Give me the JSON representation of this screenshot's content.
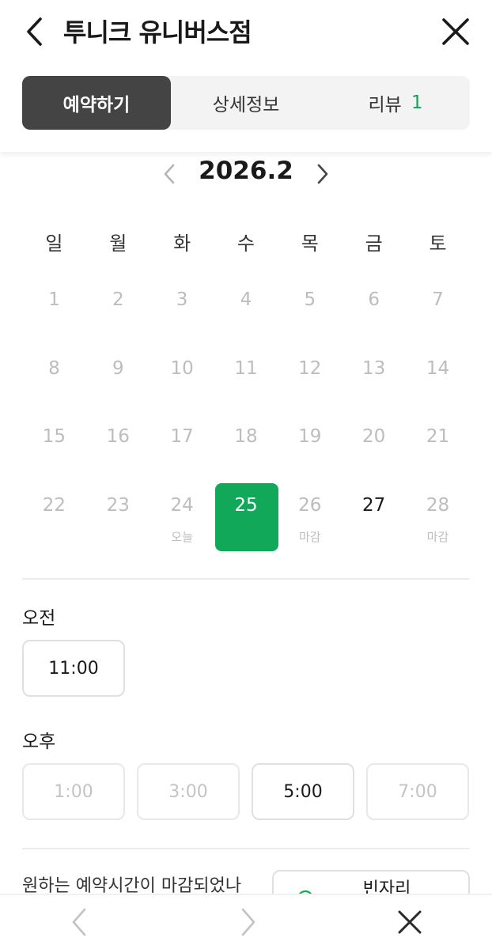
{
  "header": {
    "title": "투니크 유니버스점"
  },
  "tabs": [
    {
      "label": "예약하기",
      "active": true
    },
    {
      "label": "상세정보",
      "active": false
    },
    {
      "label": "리뷰",
      "count": "1",
      "active": false
    }
  ],
  "calendar": {
    "month_label": "2026.2",
    "weekdays": [
      "일",
      "월",
      "화",
      "수",
      "목",
      "금",
      "토"
    ],
    "weeks": [
      [
        {
          "day": "1",
          "note": ""
        },
        {
          "day": "2",
          "note": ""
        },
        {
          "day": "3",
          "note": ""
        },
        {
          "day": "4",
          "note": ""
        },
        {
          "day": "5",
          "note": ""
        },
        {
          "day": "6",
          "note": ""
        },
        {
          "day": "7",
          "note": ""
        }
      ],
      [
        {
          "day": "8",
          "note": ""
        },
        {
          "day": "9",
          "note": ""
        },
        {
          "day": "10",
          "note": ""
        },
        {
          "day": "11",
          "note": ""
        },
        {
          "day": "12",
          "note": ""
        },
        {
          "day": "13",
          "note": ""
        },
        {
          "day": "14",
          "note": ""
        }
      ],
      [
        {
          "day": "15",
          "note": ""
        },
        {
          "day": "16",
          "note": ""
        },
        {
          "day": "17",
          "note": ""
        },
        {
          "day": "18",
          "note": ""
        },
        {
          "day": "19",
          "note": ""
        },
        {
          "day": "20",
          "note": ""
        },
        {
          "day": "21",
          "note": ""
        }
      ],
      [
        {
          "day": "22",
          "note": ""
        },
        {
          "day": "23",
          "note": ""
        },
        {
          "day": "24",
          "note": "오늘"
        },
        {
          "day": "25",
          "note": "",
          "state": "selected"
        },
        {
          "day": "26",
          "note": "마감"
        },
        {
          "day": "27",
          "note": "",
          "state": "available"
        },
        {
          "day": "28",
          "note": "마감"
        }
      ]
    ]
  },
  "times": {
    "am_label": "오전",
    "am_slots": [
      {
        "label": "11:00",
        "enabled": true
      }
    ],
    "pm_label": "오후",
    "pm_slots": [
      {
        "label": "1:00",
        "enabled": false
      },
      {
        "label": "3:00",
        "enabled": false
      },
      {
        "label": "5:00",
        "enabled": true
      },
      {
        "label": "7:00",
        "enabled": false
      }
    ]
  },
  "notice": {
    "text": "원하는 예약시간이 마감되었나",
    "vacancy_label": "빈자리"
  },
  "colors": {
    "accent": "#12a85a",
    "tab_active": "#444444"
  }
}
